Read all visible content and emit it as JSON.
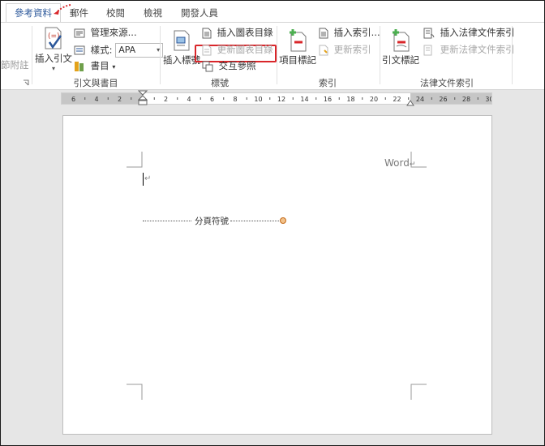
{
  "tabs": [
    {
      "label": "參考資料",
      "active": true
    },
    {
      "label": "郵件"
    },
    {
      "label": "校閱"
    },
    {
      "label": "檢視"
    },
    {
      "label": "開發人員"
    }
  ],
  "ribbon": {
    "footnote_partial": "節附註",
    "citations": {
      "insert_citation": "插入引文",
      "manage_sources": "管理來源...",
      "style_label": "樣式:",
      "style_value": "APA",
      "bibliography": "書目",
      "group_label": "引文與書目"
    },
    "captions": {
      "insert_caption": "插入標號",
      "insert_table_of_figures": "插入圖表目錄",
      "update_table": "更新圖表目錄",
      "cross_reference": "交互參照",
      "group_label": "標號"
    },
    "index": {
      "mark_entry": "項目標記",
      "insert_index": "插入索引...",
      "update_index": "更新索引",
      "group_label": "索引"
    },
    "toa": {
      "mark_citation": "引文標記",
      "insert_toa": "插入法律文件索引",
      "update_toa": "更新法律文件索引",
      "group_label": "法律文件索引"
    }
  },
  "ruler": {
    "ticks": [
      "6",
      "4",
      "2",
      "2",
      "4",
      "6",
      "8",
      "10",
      "12",
      "14",
      "16",
      "18",
      "20",
      "22",
      "24",
      "26",
      "28",
      "30"
    ]
  },
  "document": {
    "header_text": "Word",
    "page_break_label": "分頁符號"
  }
}
